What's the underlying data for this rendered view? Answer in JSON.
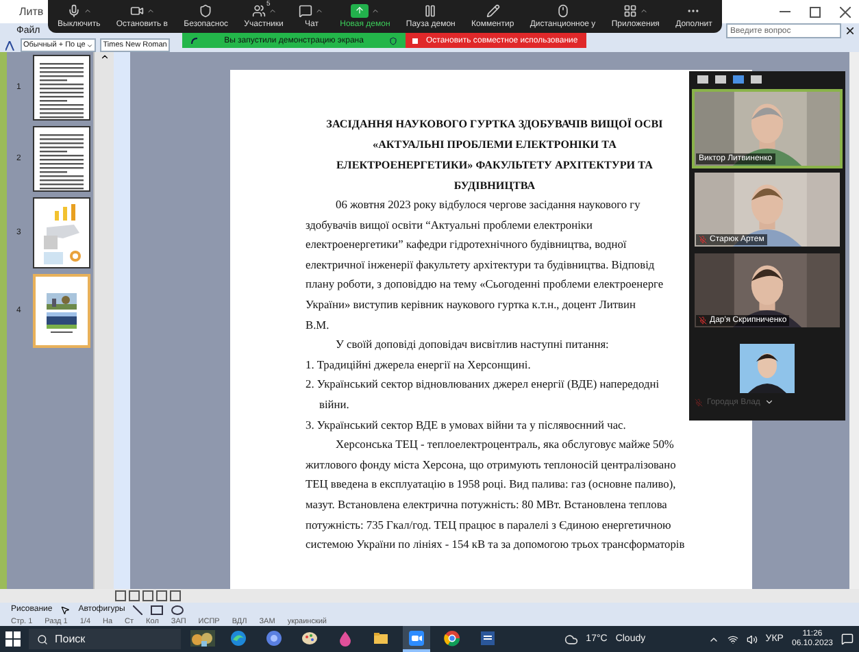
{
  "word_window": {
    "title": "Литв",
    "menu": [
      {
        "label": "Файл"
      }
    ],
    "question_field": {
      "placeholder": "Введите вопрос"
    },
    "style_box": "Обычный + По це",
    "font_box": "Times New Roman"
  },
  "meeting_toolbar": {
    "participants_count": "5",
    "items": [
      {
        "label": "Выключить",
        "highlighted": false
      },
      {
        "label": "Остановить в",
        "highlighted": false
      },
      {
        "label": "Безопаснос",
        "highlighted": false
      },
      {
        "label": "Участники",
        "highlighted": false
      },
      {
        "label": "Чат",
        "highlighted": false
      },
      {
        "label": "Новая демон",
        "highlighted": true
      },
      {
        "label": "Пауза демон",
        "highlighted": false
      },
      {
        "label": "Комментир",
        "highlighted": false
      },
      {
        "label": "Дистанционное у",
        "highlighted": false
      },
      {
        "label": "Приложения",
        "highlighted": false
      },
      {
        "label": "Дополнит",
        "highlighted": false
      }
    ]
  },
  "share_banner": {
    "message": "Вы запустили демонстрацию экрана",
    "stop_button": "Остановить совместное использование"
  },
  "thumbnails": [
    {
      "number": "1",
      "kind": "text",
      "selected": false
    },
    {
      "number": "2",
      "kind": "text",
      "selected": false
    },
    {
      "number": "3",
      "kind": "charts",
      "selected": false
    },
    {
      "number": "4",
      "kind": "photos",
      "selected": true
    }
  ],
  "document": {
    "lines": [
      {
        "kind": "title",
        "text": "ЗАСІДАННЯ НАУКОВОГО ГУРТКА ЗДОБУВАЧІВ ВИЩОЇ ОСВІ"
      },
      {
        "kind": "title",
        "text": "«АКТУАЛЬНІ ПРОБЛЕМИ ЕЛЕКТРОНІКИ ТА"
      },
      {
        "kind": "title",
        "text": "ЕЛЕКТРОЕНЕРГЕТИКИ»  ФАКУЛЬТЕТУ АРХІТЕКТУРИ ТА"
      },
      {
        "kind": "title",
        "text": "БУДІВНИЦТВА"
      },
      {
        "kind": "indent",
        "text": "06 жовтня  2023 року відбулося чергове засідання наукового гу"
      },
      {
        "kind": "plain",
        "text": "здобувачів вищої освіти “Актуальні проблеми електроніки"
      },
      {
        "kind": "plain",
        "text": "електроенергетики” кафедри гідротехнічного будівництва, водної"
      },
      {
        "kind": "plain",
        "text": "електричної інженерії факультету архітектури та будівництва. Відповід"
      },
      {
        "kind": "plain",
        "text": "плану роботи, з доповіддю на тему «Сьогоденні проблеми електроенерге"
      },
      {
        "kind": "plain",
        "text": "України» виступив керівник наукового гуртка к.т.н., доцент Литвин"
      },
      {
        "kind": "plain",
        "text": "В.М."
      },
      {
        "kind": "indent",
        "text": "У своїй доповіді доповідач висвітлив наступні питання:"
      },
      {
        "kind": "plain",
        "text": "1. Традиційні джерела енергії на Херсонщині."
      },
      {
        "kind": "plain",
        "text": "2. Український сектор відновлюваних джерел енергії (ВДЕ) напередодні"
      },
      {
        "kind": "wrap",
        "text": "війни."
      },
      {
        "kind": "plain",
        "text": "3. Український сектор ВДЕ в умовах війни та у післявоєнний час."
      },
      {
        "kind": "indent",
        "text": "Херсонська ТЕЦ - теплоелектроцентраль, яка обслуговує майже 50%"
      },
      {
        "kind": "plain",
        "text": "житлового фонду міста Херсона, що отримують теплоносій централізовано"
      },
      {
        "kind": "plain",
        "text": "ТЕЦ введена в експлуатацію в 1958 році. Вид палива: газ (основне паливо),"
      },
      {
        "kind": "plain",
        "text": "мазут. Встановлена електрична потужність: 80 МВт.  Встановлена теплова"
      },
      {
        "kind": "plain",
        "text": "потужність: 735 Гкал/год. ТЕЦ працює в паралелі з Єдиною енергетичною"
      },
      {
        "kind": "plain",
        "text": "системою України по лініях - 154 кВ та за допомогою трьох трансформаторів"
      }
    ]
  },
  "video_panel": {
    "views": [
      {
        "selected": false
      },
      {
        "selected": false
      },
      {
        "selected": true
      },
      {
        "selected": false
      }
    ],
    "participants": [
      {
        "name": "Виктор Литвиненко",
        "kind": "video",
        "muted": false,
        "speaking": true
      },
      {
        "name": "Старюк Артем",
        "kind": "video",
        "muted": true,
        "speaking": false
      },
      {
        "name": "Дар'я Скрипниченко",
        "kind": "video",
        "muted": true,
        "speaking": false
      },
      {
        "name": "Городця Влад",
        "muted": true
      }
    ]
  },
  "drawing_toolbar": {
    "menus": [
      "Рисование",
      "Автофигуры"
    ]
  },
  "status_bar": [
    "Стр. 1",
    "Разд 1",
    "1/4",
    "На",
    "Ст",
    "Кол",
    "ЗАП",
    "ИСПР",
    "ВДЛ",
    "ЗАМ",
    "украинский"
  ],
  "taskbar": {
    "search": {
      "placeholder": "Поиск"
    },
    "apps": [
      {
        "selected": false
      },
      {
        "selected": false
      },
      {
        "selected": false
      },
      {
        "selected": false
      },
      {
        "selected": false
      },
      {
        "selected": false
      },
      {
        "selected": true
      },
      {
        "selected": false
      },
      {
        "selected": false
      }
    ],
    "weather": {
      "temperature": "17°C",
      "condition": "Cloudy"
    },
    "language": "УКР",
    "time": "11:26",
    "date": "06.10.2023"
  }
}
